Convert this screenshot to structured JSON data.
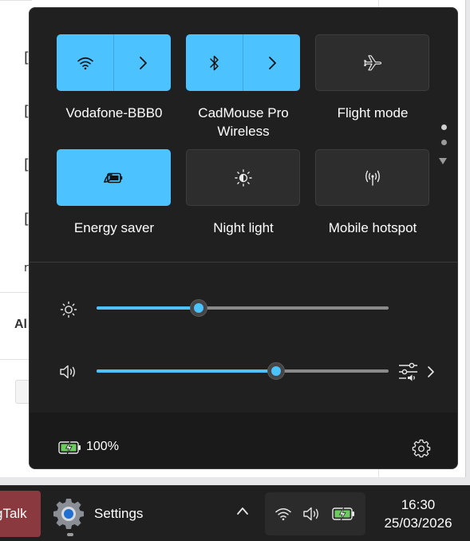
{
  "colors": {
    "accent": "#4cc2ff",
    "flyout_bg": "#202020",
    "tile_off": "#2d2d2d",
    "taskbar_bg": "#202020",
    "pinned_app_bg": "#8a3a3e"
  },
  "background_window": {
    "list_marks": [
      "[",
      "[",
      "[",
      "[",
      "r"
    ],
    "partial_text": "Al"
  },
  "quick_settings": {
    "tiles": [
      {
        "label": "Vodafone-BBB0",
        "icon": "wifi-icon",
        "state": "on",
        "has_arrow": true
      },
      {
        "label": "CadMouse Pro Wireless",
        "icon": "bluetooth-icon",
        "state": "on",
        "has_arrow": true
      },
      {
        "label": "Flight mode",
        "icon": "airplane-icon",
        "state": "off"
      },
      {
        "label": "Energy saver",
        "icon": "energy-saver-icon",
        "state": "on"
      },
      {
        "label": "Night light",
        "icon": "night-light-icon",
        "state": "off"
      },
      {
        "label": "Mobile hotspot",
        "icon": "hotspot-icon",
        "state": "off"
      }
    ],
    "page_indicator": {
      "pages": 2,
      "current": 1
    },
    "brightness": {
      "icon": "brightness-icon",
      "level": 0.35
    },
    "volume": {
      "icon": "speaker-icon",
      "level": 0.615,
      "mixer_icon": "volume-mixer-icon"
    },
    "battery": {
      "icon": "battery-charging-icon",
      "percent_text": "100%"
    },
    "settings_icon": "gear-icon"
  },
  "taskbar": {
    "pinned_app_label": "gTalk",
    "settings_label": "Settings",
    "settings_icon": "settings-gear-icon",
    "tray_icons": [
      "wifi-icon",
      "speaker-icon",
      "battery-charging-icon"
    ],
    "time": "16:30",
    "date": "25/03/2026"
  }
}
